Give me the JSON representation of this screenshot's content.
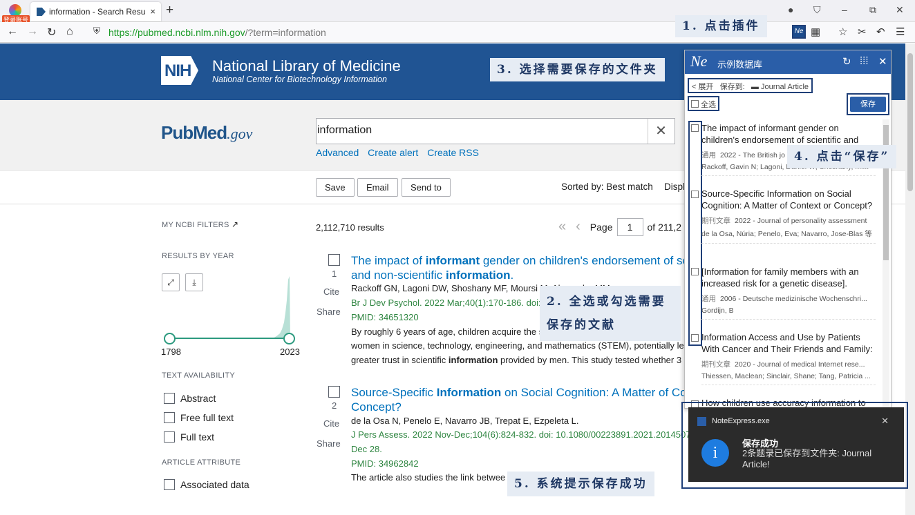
{
  "browser": {
    "profile_badge": "登录账号",
    "tab_title": "information - Search Results",
    "tab_close": "×",
    "new_tab": "+",
    "url_host_part": "https://pubmed.ncbi.nlm.nih.gov",
    "url_path_part": "/?term=information",
    "win_min": "–",
    "win_max": "⧉",
    "win_close": "✕"
  },
  "nlm": {
    "logo": "NIH",
    "title": "National Library of Medicine",
    "subtitle": "National Center for Biotechnology Information"
  },
  "pubmed": {
    "logo_main": "PubMed",
    "logo_gov": ".gov",
    "search_value": "information",
    "clear": "✕",
    "links": [
      "Advanced",
      "Create alert",
      "Create RSS"
    ]
  },
  "actions": {
    "save": "Save",
    "email": "Email",
    "send_to": "Send to",
    "sorted": "Sorted by: Best match",
    "display": "Displa"
  },
  "sidebar": {
    "my_ncbi_filters": "MY NCBI FILTERS",
    "results_by_year": "RESULTS BY YEAR",
    "year_min": "1798",
    "year_max": "2023",
    "text_availability": "TEXT AVAILABILITY",
    "text_filters": [
      "Abstract",
      "Free full text",
      "Full text"
    ],
    "article_attribute": "ARTICLE ATTRIBUTE",
    "attr_filters": [
      "Associated data"
    ]
  },
  "results": {
    "count": "2,112,710 results",
    "page_label": "Page",
    "page_value": "1",
    "page_of": "of 211,2",
    "cite": "Cite",
    "share": "Share",
    "items": [
      {
        "num": "1",
        "title_html": "The impact of <b>informant</b> gender on children's endorsement of sc and non-scientific <b>information</b>.",
        "authors": "Rackoff GN, Lagoni DW, Shoshany MF, Moursi M, Alexander MM.",
        "citation": "Br J Dev Psychol. 2022 Mar;40(1):170-186. doi: 1",
        "pmid": "PMID: 34651320",
        "snippet1": "By roughly 6 years of age, children acquire the s",
        "snippet2": "women in science, technology, engineering, and mathematics (STEM), potentially lea",
        "snippet3_html": "greater trust in scientific <b>information</b> provided by men. This study tested whether 3"
      },
      {
        "num": "2",
        "title_html": "Source-Specific <b>Information</b> on Social Cognition: A Matter of Co Concept?",
        "authors": "de la Osa N, Penelo E, Navarro JB, Trepat E, Ezpeleta L.",
        "citation": "J Pers Assess. 2022 Nov-Dec;104(6):824-832. doi: 10.1080/00223891.2021.2014507. E",
        "citation2": "Dec 28.",
        "pmid": "PMID: 34962842",
        "snippet1": "The article also studies the link betwee"
      }
    ]
  },
  "noteexpress": {
    "logo": "Ne",
    "db_name": "示例数据库",
    "expand": "< 展开",
    "save_to_label": "保存到:",
    "folder": "Journal Article",
    "select_all": "全选",
    "save_button": "保存",
    "items": [
      {
        "title": "The impact of informant gender on children's endorsement of scientific and",
        "type": "通用",
        "meta": "2022 - The British jo",
        "authors": "Rackoff, Gavin N; Lagoni, Daniel W; Shoshany, Mi..."
      },
      {
        "title": "Source-Specific Information on Social Cognition: A Matter of Context or Concept?",
        "type": "期刊文章",
        "meta": "2022 - Journal of personality assessment",
        "authors": "de la Osa, Núria; Penelo, Eva; Navarro, Jose-Blas 等"
      },
      {
        "title": "[Information for family members with an increased risk for a genetic disease].",
        "type": "通用",
        "meta": "2006 - Deutsche medizinische Wochenschri...",
        "authors": "Gordijn, B"
      },
      {
        "title": "Information Access and Use by Patients With Cancer and Their Friends and Family:",
        "type": "期刊文章",
        "meta": "2020 - Journal of medical Internet rese...",
        "authors": "Thiessen, Maclean; Sinclair, Shane; Tang, Patricia ..."
      },
      {
        "title": "How children use accuracy information to"
      }
    ]
  },
  "toast": {
    "app": "NoteExpress.exe",
    "close": "✕",
    "title": "保存成功",
    "message": "2条题录已保存到文件夹: Journal Article!"
  },
  "callouts": {
    "step1": "1. 点击插件",
    "step2": "2. 全选或勾选需要保存的文献",
    "step3": "3. 选择需要保存的文件夹",
    "step4": "4. 点击“保存”",
    "step5": "5. 系统提示保存成功"
  },
  "colors": {
    "nlm_blue": "#205493",
    "ne_blue": "#2a5ea8",
    "callout_text": "#1f3864",
    "link": "#0071bc",
    "citation_green": "#2e8540"
  }
}
